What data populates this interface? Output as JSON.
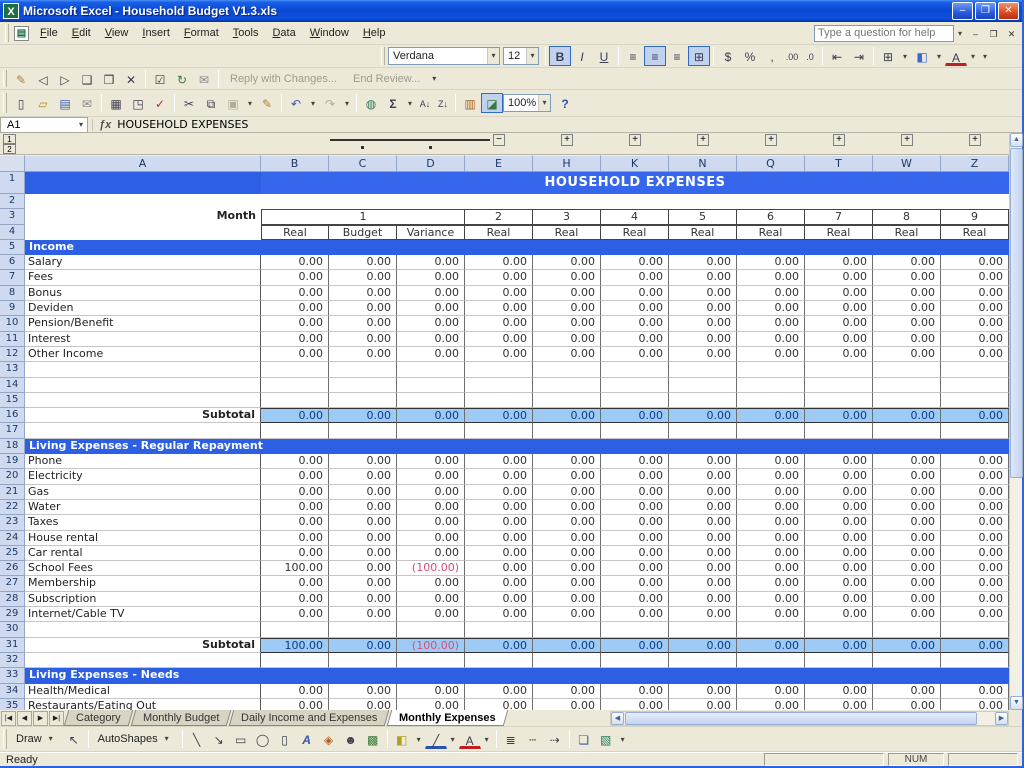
{
  "window": {
    "title": "Microsoft Excel - Household Budget V1.3.xls"
  },
  "menu": {
    "items": [
      "File",
      "Edit",
      "View",
      "Insert",
      "Format",
      "Tools",
      "Data",
      "Window",
      "Help"
    ],
    "help_placeholder": "Type a question for help"
  },
  "review_toolbar": {
    "reply_label": "Reply with Changes...",
    "end_label": "End Review..."
  },
  "formatting_toolbar": {
    "font_name": "Verdana",
    "font_size": "12"
  },
  "standard_toolbar": {
    "zoom_value": "100%"
  },
  "formula_bar": {
    "cell_reference": "A1",
    "content": "HOUSEHOLD EXPENSES"
  },
  "grid": {
    "outline_level_buttons": [
      "1",
      "2"
    ],
    "column_letters": [
      "A",
      "B",
      "C",
      "D",
      "E",
      "H",
      "K",
      "N",
      "Q",
      "T",
      "W",
      "Z"
    ],
    "value_columns": [
      "B",
      "C",
      "D",
      "E",
      "H",
      "K",
      "N",
      "Q",
      "T",
      "W",
      "Z"
    ],
    "outline": {
      "expanded_group_dots": [
        "C",
        "D"
      ],
      "collapse_button_column": "E",
      "expand_button_columns": [
        "H",
        "K",
        "N",
        "Q",
        "T",
        "W",
        "Z"
      ]
    },
    "title_row_text": "HOUSEHOLD EXPENSES",
    "rows": [
      {
        "n": 1,
        "type": "title"
      },
      {
        "n": 2,
        "type": "blank"
      },
      {
        "n": 3,
        "type": "month",
        "label": "Month",
        "months": [
          "1",
          "2",
          "3",
          "4",
          "5",
          "6",
          "7",
          "8",
          "9"
        ]
      },
      {
        "n": 4,
        "type": "heads",
        "labels": [
          "Real",
          "Budget",
          "Variance",
          "Real",
          "Real",
          "Real",
          "Real",
          "Real",
          "Real",
          "Real",
          "Real"
        ]
      },
      {
        "n": 5,
        "type": "section",
        "label": "Income"
      },
      {
        "n": 6,
        "type": "data",
        "label": "Salary",
        "values": [
          "0.00",
          "0.00",
          "0.00",
          "0.00",
          "0.00",
          "0.00",
          "0.00",
          "0.00",
          "0.00",
          "0.00",
          "0.00"
        ]
      },
      {
        "n": 7,
        "type": "data",
        "label": "Fees",
        "values": [
          "0.00",
          "0.00",
          "0.00",
          "0.00",
          "0.00",
          "0.00",
          "0.00",
          "0.00",
          "0.00",
          "0.00",
          "0.00"
        ]
      },
      {
        "n": 8,
        "type": "data",
        "label": "Bonus",
        "values": [
          "0.00",
          "0.00",
          "0.00",
          "0.00",
          "0.00",
          "0.00",
          "0.00",
          "0.00",
          "0.00",
          "0.00",
          "0.00"
        ]
      },
      {
        "n": 9,
        "type": "data",
        "label": "Deviden",
        "values": [
          "0.00",
          "0.00",
          "0.00",
          "0.00",
          "0.00",
          "0.00",
          "0.00",
          "0.00",
          "0.00",
          "0.00",
          "0.00"
        ]
      },
      {
        "n": 10,
        "type": "data",
        "label": "Pension/Benefit",
        "values": [
          "0.00",
          "0.00",
          "0.00",
          "0.00",
          "0.00",
          "0.00",
          "0.00",
          "0.00",
          "0.00",
          "0.00",
          "0.00"
        ]
      },
      {
        "n": 11,
        "type": "data",
        "label": "Interest",
        "values": [
          "0.00",
          "0.00",
          "0.00",
          "0.00",
          "0.00",
          "0.00",
          "0.00",
          "0.00",
          "0.00",
          "0.00",
          "0.00"
        ]
      },
      {
        "n": 12,
        "type": "data",
        "label": "Other Income",
        "values": [
          "0.00",
          "0.00",
          "0.00",
          "0.00",
          "0.00",
          "0.00",
          "0.00",
          "0.00",
          "0.00",
          "0.00",
          "0.00"
        ]
      },
      {
        "n": 13,
        "type": "empty"
      },
      {
        "n": 14,
        "type": "empty"
      },
      {
        "n": 15,
        "type": "empty"
      },
      {
        "n": 16,
        "type": "subtotal",
        "label": "Subtotal",
        "values": [
          "0.00",
          "0.00",
          "0.00",
          "0.00",
          "0.00",
          "0.00",
          "0.00",
          "0.00",
          "0.00",
          "0.00",
          "0.00"
        ]
      },
      {
        "n": 17,
        "type": "empty"
      },
      {
        "n": 18,
        "type": "section",
        "label": "Living Expenses - Regular Repayment"
      },
      {
        "n": 19,
        "type": "data",
        "label": "Phone",
        "values": [
          "0.00",
          "0.00",
          "0.00",
          "0.00",
          "0.00",
          "0.00",
          "0.00",
          "0.00",
          "0.00",
          "0.00",
          "0.00"
        ]
      },
      {
        "n": 20,
        "type": "data",
        "label": "Electricity",
        "values": [
          "0.00",
          "0.00",
          "0.00",
          "0.00",
          "0.00",
          "0.00",
          "0.00",
          "0.00",
          "0.00",
          "0.00",
          "0.00"
        ]
      },
      {
        "n": 21,
        "type": "data",
        "label": "Gas",
        "values": [
          "0.00",
          "0.00",
          "0.00",
          "0.00",
          "0.00",
          "0.00",
          "0.00",
          "0.00",
          "0.00",
          "0.00",
          "0.00"
        ]
      },
      {
        "n": 22,
        "type": "data",
        "label": "Water",
        "values": [
          "0.00",
          "0.00",
          "0.00",
          "0.00",
          "0.00",
          "0.00",
          "0.00",
          "0.00",
          "0.00",
          "0.00",
          "0.00"
        ]
      },
      {
        "n": 23,
        "type": "data",
        "label": "Taxes",
        "values": [
          "0.00",
          "0.00",
          "0.00",
          "0.00",
          "0.00",
          "0.00",
          "0.00",
          "0.00",
          "0.00",
          "0.00",
          "0.00"
        ]
      },
      {
        "n": 24,
        "type": "data",
        "label": "House rental",
        "values": [
          "0.00",
          "0.00",
          "0.00",
          "0.00",
          "0.00",
          "0.00",
          "0.00",
          "0.00",
          "0.00",
          "0.00",
          "0.00"
        ]
      },
      {
        "n": 25,
        "type": "data",
        "label": "Car rental",
        "values": [
          "0.00",
          "0.00",
          "0.00",
          "0.00",
          "0.00",
          "0.00",
          "0.00",
          "0.00",
          "0.00",
          "0.00",
          "0.00"
        ]
      },
      {
        "n": 26,
        "type": "data",
        "label": "School Fees",
        "values": [
          "100.00",
          "0.00",
          "(100.00)",
          "0.00",
          "0.00",
          "0.00",
          "0.00",
          "0.00",
          "0.00",
          "0.00",
          "0.00"
        ]
      },
      {
        "n": 27,
        "type": "data",
        "label": "Membership",
        "values": [
          "0.00",
          "0.00",
          "0.00",
          "0.00",
          "0.00",
          "0.00",
          "0.00",
          "0.00",
          "0.00",
          "0.00",
          "0.00"
        ]
      },
      {
        "n": 28,
        "type": "data",
        "label": "Subscription",
        "values": [
          "0.00",
          "0.00",
          "0.00",
          "0.00",
          "0.00",
          "0.00",
          "0.00",
          "0.00",
          "0.00",
          "0.00",
          "0.00"
        ]
      },
      {
        "n": 29,
        "type": "data",
        "label": "Internet/Cable TV",
        "values": [
          "0.00",
          "0.00",
          "0.00",
          "0.00",
          "0.00",
          "0.00",
          "0.00",
          "0.00",
          "0.00",
          "0.00",
          "0.00"
        ]
      },
      {
        "n": 30,
        "type": "empty"
      },
      {
        "n": 31,
        "type": "subtotal",
        "label": "Subtotal",
        "values": [
          "100.00",
          "0.00",
          "(100.00)",
          "0.00",
          "0.00",
          "0.00",
          "0.00",
          "0.00",
          "0.00",
          "0.00",
          "0.00"
        ]
      },
      {
        "n": 32,
        "type": "empty"
      },
      {
        "n": 33,
        "type": "section",
        "label": "Living Expenses - Needs"
      },
      {
        "n": 34,
        "type": "data",
        "label": "Health/Medical",
        "values": [
          "0.00",
          "0.00",
          "0.00",
          "0.00",
          "0.00",
          "0.00",
          "0.00",
          "0.00",
          "0.00",
          "0.00",
          "0.00"
        ]
      },
      {
        "n": 35,
        "type": "data",
        "label": "Restaurants/Eating Out",
        "values": [
          "0.00",
          "0.00",
          "0.00",
          "0.00",
          "0.00",
          "0.00",
          "0.00",
          "0.00",
          "0.00",
          "0.00",
          "0.00"
        ]
      }
    ]
  },
  "sheet_tabs": {
    "tabs": [
      {
        "label": "Category",
        "active": false
      },
      {
        "label": "Monthly Budget",
        "active": false
      },
      {
        "label": "Daily Income and Expenses",
        "active": false
      },
      {
        "label": "Monthly Expenses",
        "active": true
      }
    ]
  },
  "drawing_toolbar": {
    "draw_label": "Draw",
    "autoshapes_label": "AutoShapes"
  },
  "status_bar": {
    "mode": "Ready",
    "num_lock": "NUM"
  },
  "colors": {
    "title_bar": "#0c49d2",
    "section_bg": "#2d5fe4",
    "title_bg": "#3566ec",
    "subtotal_bg": "#9dcbf6",
    "subtotal_text": "#0b3a86",
    "negative": "#d94f77",
    "header_bg": "#cfdaf0",
    "grid_line": "#c6c6c6"
  },
  "icons": {
    "excel_logo": "X",
    "workbook": "▤",
    "win_minimize": "–",
    "win_restore": "❐",
    "win_close": "✕",
    "dropdown": "▾",
    "new": "▯",
    "open": "▱",
    "save": "▤",
    "email": "✉",
    "print": "▦",
    "print_preview": "◳",
    "spelling": "✓",
    "cut": "✂",
    "copy": "⧉",
    "paste": "▣",
    "format_painter": "✎",
    "undo": "↶",
    "redo": "↷",
    "hyperlink": "◍",
    "autosum": "Σ",
    "sort_az": "A↓",
    "sort_za": "Z↓",
    "chart_wizard": "▥",
    "drawing": "◪",
    "help": "?",
    "bold": "B",
    "italic": "I",
    "underline": "U",
    "align_left": "≡",
    "align_center": "≡",
    "align_right": "≡",
    "merge_center": "⊞",
    "currency": "$",
    "percent": "%",
    "comma": ",",
    "inc_decimal": ".00",
    "dec_decimal": ".0",
    "dec_indent": "⇤",
    "inc_indent": "⇥",
    "borders": "⊞",
    "fill_color": "◧",
    "font_color": "A",
    "edit_comment": "✎",
    "previous_comment": "◁",
    "next_comment": "▷",
    "show_comment": "❑",
    "show_all_comments": "❒",
    "delete_comment": "✕",
    "outlook_task": "☑",
    "update_file": "↻",
    "mail_recipient": "✉",
    "fx": "ƒx",
    "up_arrow": "▲",
    "down_arrow": "▼",
    "left_arrow": "◀",
    "right_arrow": "▶",
    "tab_first": "|◀",
    "tab_prev": "◀",
    "tab_next": "▶",
    "tab_last": "▶|",
    "select_pointer": "↖",
    "line": "╲",
    "arrow": "↘",
    "rectangle": "▭",
    "oval": "◯",
    "text_box": "▯",
    "wordart": "A",
    "diagram": "◈",
    "clip_art": "☻",
    "picture": "▩",
    "draw_fill": "◧",
    "draw_line_color": "╱",
    "draw_font_color": "A",
    "line_style": "≣",
    "dash_style": "┄",
    "arrow_style": "⇢",
    "shadow_style": "❏",
    "threed_style": "▧",
    "plus": "+",
    "minus": "−"
  }
}
